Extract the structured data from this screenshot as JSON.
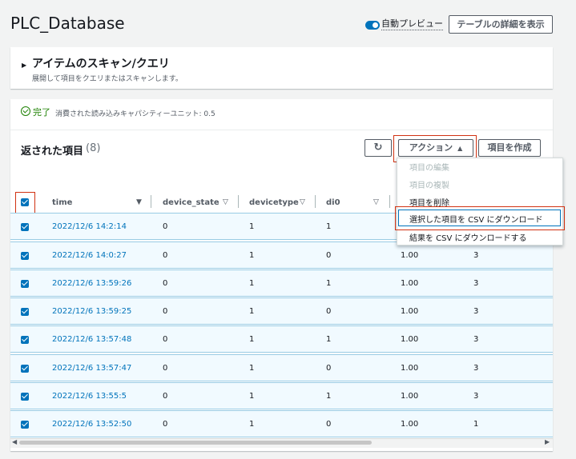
{
  "page": {
    "title": "PLC_Database"
  },
  "toolbar": {
    "auto_preview_label": "自動プレビュー",
    "details_button": "テーブルの詳細を表示"
  },
  "scan": {
    "title": "アイテムのスキャン/クエリ",
    "description": "展開して項目をクエリまたはスキャンします。"
  },
  "status": {
    "text": "完了",
    "capacity": "消費された読み込みキャパシティーユニット: 0.5"
  },
  "items": {
    "title": "返された項目",
    "count": "(8)",
    "refresh_icon": "↻",
    "action_button": "アクション",
    "action_caret": "▲",
    "create_button": "項目を作成"
  },
  "columns": [
    "time",
    "device_state",
    "devicetype",
    "di0"
  ],
  "sort_icons": {
    "time": "▼",
    "other": "▽"
  },
  "menu": {
    "items": [
      "項目の編集",
      "項目の複製",
      "項目を削除",
      "選択した項目を CSV にダウンロード",
      "結果を CSV にダウンロードする"
    ]
  },
  "rows": [
    [
      "2022/12/6 14:2:14",
      "0",
      "1",
      "1",
      "",
      ""
    ],
    [
      "2022/12/6 14:0:27",
      "0",
      "1",
      "0",
      "1.00",
      "3"
    ],
    [
      "2022/12/6 13:59:26",
      "0",
      "1",
      "1",
      "1.00",
      "3"
    ],
    [
      "2022/12/6 13:59:25",
      "0",
      "1",
      "0",
      "1.00",
      "3"
    ],
    [
      "2022/12/6 13:57:48",
      "0",
      "1",
      "1",
      "1.00",
      "3"
    ],
    [
      "2022/12/6 13:57:47",
      "0",
      "1",
      "0",
      "1.00",
      "3"
    ],
    [
      "2022/12/6 13:55:5",
      "0",
      "1",
      "1",
      "1.00",
      "3"
    ],
    [
      "2022/12/6 13:52:50",
      "0",
      "1",
      "0",
      "1.00",
      "1"
    ]
  ],
  "scroll": {
    "left": "◀",
    "right": "▶"
  },
  "colors": {
    "accent": "#0073bb",
    "success": "#1d8102",
    "highlight": "#d13212"
  }
}
